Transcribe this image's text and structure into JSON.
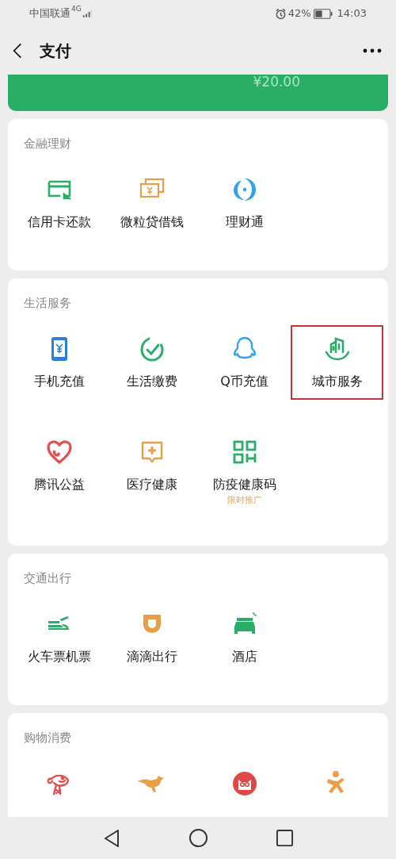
{
  "status_bar": {
    "carrier": "中国联通",
    "network": "4G",
    "battery": "42%",
    "time": "14:03"
  },
  "header": {
    "title": "支付"
  },
  "balance_card": {
    "amount": "¥20.00"
  },
  "sections": [
    {
      "title": "金融理财",
      "items": [
        {
          "kind": "labeled",
          "label": "信用卡还款",
          "highlighted": false
        },
        {
          "kind": "labeled",
          "label": "微粒贷借钱",
          "highlighted": false
        },
        {
          "kind": "labeled",
          "label": "理财通",
          "highlighted": false
        }
      ]
    },
    {
      "title": "生活服务",
      "items": [
        {
          "kind": "labeled",
          "label": "手机充值",
          "highlighted": false
        },
        {
          "kind": "labeled",
          "label": "生活缴费",
          "highlighted": false
        },
        {
          "kind": "labeled",
          "label": "Q币充值",
          "highlighted": false
        },
        {
          "kind": "labeled",
          "label": "城市服务",
          "highlighted": true
        },
        {
          "kind": "labeled",
          "label": "腾讯公益",
          "highlighted": false
        },
        {
          "kind": "labeled",
          "label": "医疗健康",
          "highlighted": false
        },
        {
          "kind": "labeled",
          "label": "防疫健康码",
          "note": "限时推广",
          "highlighted": false
        }
      ]
    },
    {
      "title": "交通出行",
      "items": [
        {
          "kind": "labeled",
          "label": "火车票机票",
          "highlighted": false
        },
        {
          "kind": "labeled",
          "label": "滴滴出行",
          "highlighted": false
        },
        {
          "kind": "labeled",
          "label": "酒店",
          "highlighted": false
        }
      ]
    },
    {
      "title": "购物消费",
      "items": [
        {
          "kind": "icon-only"
        },
        {
          "kind": "icon-only"
        },
        {
          "kind": "icon-only"
        },
        {
          "kind": "icon-only"
        }
      ]
    }
  ]
}
